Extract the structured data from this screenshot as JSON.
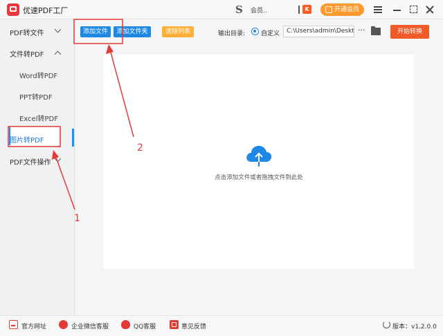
{
  "app": {
    "title": "优速PDF工厂"
  },
  "titlebar": {
    "user_initial": "S",
    "user_name": "会员..",
    "badge": "K",
    "vip_label": "开通会员"
  },
  "sidebar": {
    "groups": [
      {
        "label": "PDF转文件",
        "expanded": false
      },
      {
        "label": "文件转PDF",
        "expanded": true,
        "items": [
          "Word转PDF",
          "PPT转PDF",
          "Excel转PDF",
          "图片转PDF"
        ],
        "selected": "图片转PDF"
      },
      {
        "label": "PDF文件操作",
        "expanded": false
      }
    ]
  },
  "toolbar": {
    "add_file": "添加文件",
    "add_folder": "添加文件夹",
    "clear_list": "清除列表",
    "output_label": "输出目录:",
    "custom_label": "自定义",
    "output_path": "C:\\Users\\admin\\Deskto",
    "more": "···",
    "start": "开始转换"
  },
  "main": {
    "drop_hint": "点击添加文件或者拖拽文件到此处"
  },
  "bottombar": {
    "site": "官方网址",
    "wechat": "企业微信客服",
    "qq": "QQ客服",
    "feedback": "意见反馈",
    "version": "版本：v1.2.0.0"
  },
  "annotations": {
    "label_1": "1",
    "label_2": "2",
    "color": "#e53935"
  },
  "colors": {
    "accent_blue": "#1e88e5",
    "accent_orange": "#ffae36",
    "start_red": "#f05a28",
    "vip_orange": "#ff9a2e"
  }
}
